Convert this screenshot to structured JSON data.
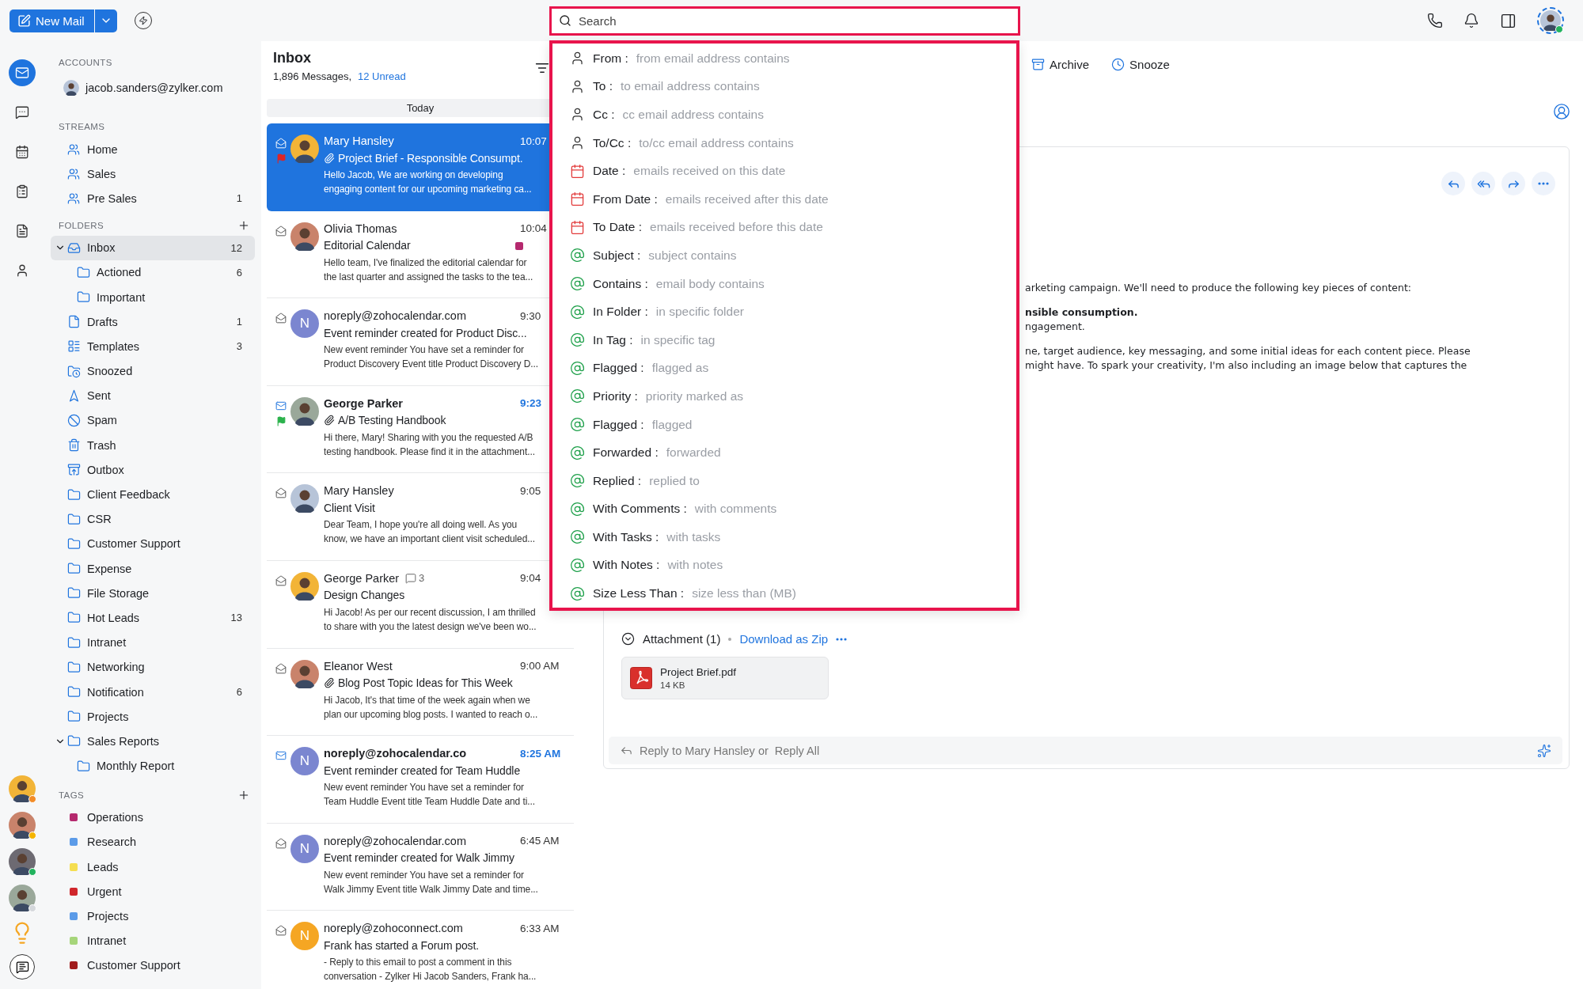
{
  "toolbar": {
    "new_mail": "New Mail"
  },
  "search": {
    "placeholder": "Search"
  },
  "search_suggestions": [
    {
      "kind": "person",
      "field": "From :",
      "hint": "from email address contains"
    },
    {
      "kind": "person",
      "field": "To :",
      "hint": "to email address contains"
    },
    {
      "kind": "person",
      "field": "Cc :",
      "hint": "cc email address contains"
    },
    {
      "kind": "person",
      "field": "To/Cc :",
      "hint": "to/cc email address contains"
    },
    {
      "kind": "date",
      "field": "Date :",
      "hint": "emails received on this date"
    },
    {
      "kind": "date",
      "field": "From Date :",
      "hint": "emails received after this date"
    },
    {
      "kind": "date",
      "field": "To Date :",
      "hint": "emails received before this date"
    },
    {
      "kind": "mention",
      "field": "Subject :",
      "hint": "subject contains"
    },
    {
      "kind": "mention",
      "field": "Contains :",
      "hint": "email body contains"
    },
    {
      "kind": "mention",
      "field": "In Folder :",
      "hint": "in specific folder"
    },
    {
      "kind": "mention",
      "field": "In Tag :",
      "hint": "in specific tag"
    },
    {
      "kind": "mention",
      "field": "Flagged :",
      "hint": "flagged as"
    },
    {
      "kind": "mention",
      "field": "Priority :",
      "hint": "priority marked as"
    },
    {
      "kind": "mention",
      "field": "Flagged :",
      "hint": "flagged"
    },
    {
      "kind": "mention",
      "field": "Forwarded :",
      "hint": "forwarded"
    },
    {
      "kind": "mention",
      "field": "Replied :",
      "hint": "replied to"
    },
    {
      "kind": "mention",
      "field": "With Comments :",
      "hint": "with comments"
    },
    {
      "kind": "mention",
      "field": "With Tasks :",
      "hint": "with tasks"
    },
    {
      "kind": "mention",
      "field": "With Notes :",
      "hint": "with notes"
    },
    {
      "kind": "mention",
      "field": "Size Less Than :",
      "hint": "size less than (MB)"
    }
  ],
  "rail": [
    {
      "kind": "mail",
      "selected": true
    },
    {
      "kind": "chat",
      "selected": false
    },
    {
      "kind": "calendar",
      "selected": false
    },
    {
      "kind": "tasks",
      "selected": false
    },
    {
      "kind": "notes",
      "selected": false
    },
    {
      "kind": "contacts",
      "selected": false
    }
  ],
  "contacts": [
    {
      "color": "#f28c28"
    },
    {
      "color": "#f5b400"
    },
    {
      "color": "#22b35e"
    },
    {
      "color": "#d5d8dc"
    }
  ],
  "accounts": {
    "heading": "ACCOUNTS",
    "email": "jacob.sanders@zylker.com"
  },
  "streams": {
    "heading": "STREAMS",
    "items": [
      {
        "name": "Home"
      },
      {
        "name": "Sales"
      },
      {
        "name": "Pre Sales",
        "count": "1"
      }
    ]
  },
  "folders": {
    "heading": "FOLDERS",
    "items": [
      {
        "kind": "inbox",
        "name": "Inbox",
        "count": "12",
        "selected": true,
        "expanded": true,
        "children": [
          {
            "kind": "folder",
            "name": "Actioned",
            "count": "6",
            "selected": false
          },
          {
            "kind": "folder",
            "name": "Important",
            "selected": false
          }
        ]
      },
      {
        "kind": "drafts",
        "name": "Drafts",
        "count": "1",
        "selected": false
      },
      {
        "kind": "templates",
        "name": "Templates",
        "count": "3",
        "selected": false
      },
      {
        "kind": "snoozed",
        "name": "Snoozed",
        "selected": false
      },
      {
        "kind": "sent",
        "name": "Sent",
        "selected": false
      },
      {
        "kind": "spam",
        "name": "Spam",
        "selected": false
      },
      {
        "kind": "trash",
        "name": "Trash",
        "selected": false
      },
      {
        "kind": "outbox",
        "name": "Outbox",
        "selected": false
      },
      {
        "kind": "folder",
        "name": "Client Feedback",
        "selected": false
      },
      {
        "kind": "folder",
        "name": "CSR",
        "selected": false
      },
      {
        "kind": "folder",
        "name": "Customer Support",
        "selected": false
      },
      {
        "kind": "folder",
        "name": "Expense",
        "selected": false
      },
      {
        "kind": "folder",
        "name": "File Storage",
        "selected": false
      },
      {
        "kind": "folder",
        "name": "Hot Leads",
        "count": "13",
        "selected": false
      },
      {
        "kind": "folder",
        "name": "Intranet",
        "selected": false
      },
      {
        "kind": "folder",
        "name": "Networking",
        "selected": false
      },
      {
        "kind": "folder",
        "name": "Notification",
        "count": "6",
        "selected": false
      },
      {
        "kind": "folder",
        "name": "Projects",
        "selected": false
      },
      {
        "kind": "folder",
        "name": "Sales Reports",
        "selected": false,
        "expanded": true,
        "children": [
          {
            "kind": "folder",
            "name": "Monthly Report",
            "selected": false
          }
        ]
      }
    ]
  },
  "tags": {
    "heading": "TAGS",
    "items": [
      {
        "name": "Operations",
        "color": "#b5296e"
      },
      {
        "name": "Research",
        "color": "#5b9be8"
      },
      {
        "name": "Leads",
        "color": "#f5de50"
      },
      {
        "name": "Urgent",
        "color": "#d0262b"
      },
      {
        "name": "Projects",
        "color": "#5b9be8"
      },
      {
        "name": "Intranet",
        "color": "#a6d57a"
      },
      {
        "name": "Customer Support",
        "color": "#a11c1c"
      }
    ]
  },
  "mail_list": {
    "title": "Inbox",
    "count": "1,896 Messages,",
    "unread": "12 Unread",
    "group": "Today",
    "mails": [
      {
        "sender": "Mary Hansley",
        "time": "10:07",
        "subject": "Project Brief - Responsible Consumpt.",
        "preview": [
          "Hello Jacob, We are working on developing",
          "engaging content for our upcoming marketing ca..."
        ],
        "selected": true,
        "unread": false,
        "flag": {
          "color": "#e02424"
        },
        "attachment": true,
        "avatar": {
          "kind": "photo"
        }
      },
      {
        "sender": "Olivia Thomas",
        "time": "10:04",
        "subject": "Editorial Calendar",
        "preview": [
          "Hello team, I've finalized the editorial calendar for",
          "the last quarter and assigned the tasks to the tea..."
        ],
        "selected": false,
        "unread": false,
        "attachment": false,
        "tag": {
          "color": "#b5296e"
        },
        "avatar": {
          "kind": "photo"
        }
      },
      {
        "sender": "noreply@zohocalendar.com",
        "time": "9:30",
        "subject": "Event reminder created for Product Disc...",
        "preview": [
          "New event reminder You have set a reminder for",
          "Product Discovery Event title Product Discovery D..."
        ],
        "selected": false,
        "unread": false,
        "attachment": false,
        "avatar": {
          "kind": "letter",
          "letter": "N",
          "color": "#7b86d0"
        }
      },
      {
        "sender": "George Parker",
        "time": "9:23",
        "subject": "A/B Testing Handbook",
        "preview": [
          "Hi there, Mary! Sharing with you the requested A/B",
          "testing handbook. Please find it in the attachment..."
        ],
        "selected": false,
        "unread": true,
        "flag": {
          "color": "#2bb24c"
        },
        "attachment": true,
        "avatar": {
          "kind": "photo"
        }
      },
      {
        "sender": "Mary Hansley",
        "time": "9:05",
        "subject": "Client Visit",
        "preview": [
          "Dear Team, I hope you're all doing well. As you",
          "know, we have an important client visit scheduled..."
        ],
        "selected": false,
        "unread": false,
        "attachment": false,
        "avatar": {
          "kind": "photo"
        }
      },
      {
        "sender": "George Parker",
        "time": "9:04",
        "subject": "Design Changes",
        "comments": "3",
        "preview": [
          "Hi Jacob! As per our recent discussion, I am thrilled",
          "to share with you the latest design we've been wo..."
        ],
        "selected": false,
        "unread": false,
        "attachment": false,
        "avatar": {
          "kind": "photo"
        }
      },
      {
        "sender": "Eleanor West",
        "time": "9:00 AM",
        "subject": "Blog Post Topic Ideas for This Week",
        "preview": [
          "Hi Jacob, It's that time of the week again when we",
          "plan our upcoming blog posts. I wanted to reach o..."
        ],
        "selected": false,
        "unread": false,
        "attachment": true,
        "avatar": {
          "kind": "photo"
        }
      },
      {
        "sender": "noreply@zohocalendar.co",
        "time": "8:25 AM",
        "subject": "Event reminder created for Team Huddle",
        "preview": [
          "New event reminder You have set a reminder for",
          "Team Huddle Event title Team Huddle Date and ti..."
        ],
        "selected": false,
        "unread": true,
        "attachment": false,
        "avatar": {
          "kind": "letter",
          "letter": "N",
          "color": "#7b86d0"
        }
      },
      {
        "sender": "noreply@zohocalendar.com",
        "time": "6:45 AM",
        "subject": "Event reminder created for Walk Jimmy",
        "preview": [
          "New event reminder You have set a reminder for",
          "Walk Jimmy Event title Walk Jimmy Date and time..."
        ],
        "selected": false,
        "unread": false,
        "attachment": false,
        "avatar": {
          "kind": "letter",
          "letter": "N",
          "color": "#7b86d0"
        }
      },
      {
        "sender": "noreply@zohoconnect.com",
        "time": "6:33 AM",
        "subject": "Frank has started a Forum post.",
        "preview": [
          "- Reply to this email to post a comment in this",
          "conversation - Zylker Hi Jacob Sanders, Frank ha..."
        ],
        "selected": false,
        "unread": false,
        "attachment": false,
        "avatar": {
          "kind": "letter",
          "letter": "N",
          "color": "#f5a623"
        }
      }
    ]
  },
  "reader": {
    "actions": [
      {
        "kind": "archive",
        "label": "Archive"
      },
      {
        "kind": "snooze",
        "label": "Snooze"
      }
    ],
    "body": [
      {
        "lines": [
          {
            "text": "arketing campaign. We'll need to produce the following key pieces of content:",
            "bold": false
          }
        ]
      },
      {
        "lines": [
          {
            "text": "nsible consumption.",
            "bold": true
          },
          {
            "text": "ngagement.",
            "bold": false
          }
        ]
      },
      {
        "lines": [
          {
            "text": "ne, target audience, key messaging, and some initial ideas for each content piece. Please",
            "bold": false
          },
          {
            "text": "might have. To spark your creativity, I'm also including an image below that captures the",
            "bold": false
          }
        ]
      }
    ],
    "attachment": {
      "title": "Attachment (1)",
      "download": "Download as Zip",
      "files": [
        {
          "name": "Project Brief.pdf",
          "size": "14 KB"
        }
      ]
    },
    "reply": {
      "to": "Reply to Mary Hansley or",
      "all": "Reply All"
    }
  }
}
